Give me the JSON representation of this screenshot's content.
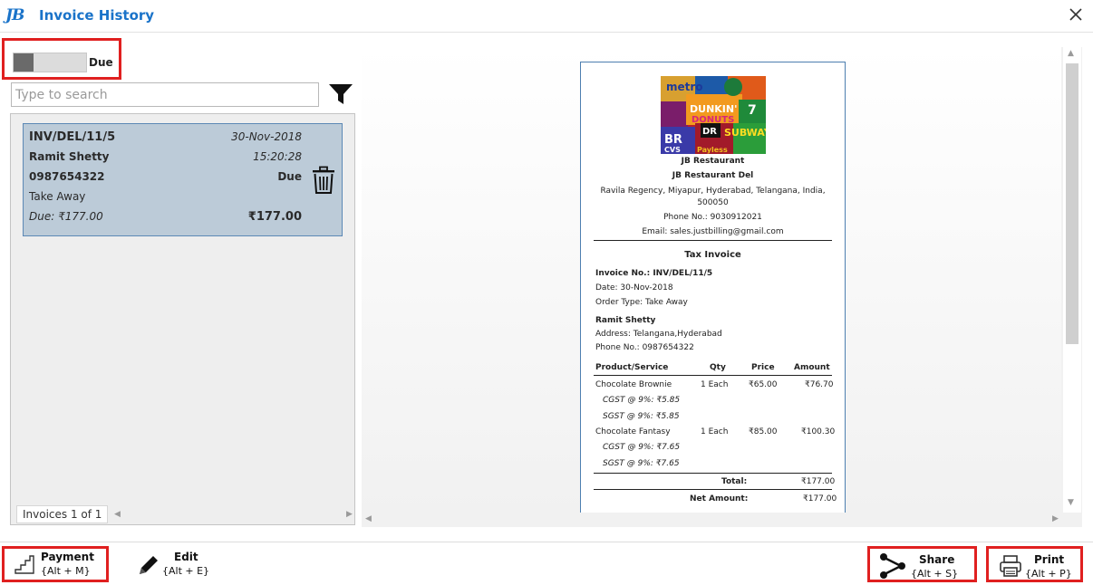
{
  "window": {
    "logo": "JB",
    "title": "Invoice History"
  },
  "toggle": {
    "label": "Due"
  },
  "search": {
    "placeholder": "Type to search"
  },
  "invoices": [
    {
      "number": "INV/DEL/11/5",
      "date": "30-Nov-2018",
      "customer": "Ramit Shetty",
      "time": "15:20:28",
      "phone": "0987654322",
      "status": "Due",
      "order_type": "Take Away",
      "due": "Due: ₹177.00",
      "total": "₹177.00"
    }
  ],
  "list_status": "Invoices 1 of 1",
  "receipt": {
    "business_name": "JB Restaurant",
    "branch_name": "JB Restaurant Del",
    "address_line1": "Ravila Regency, Miyapur, Hyderabad, Telangana, India,",
    "address_line2": "500050",
    "phone": "Phone No.: 9030912021",
    "email": "Email: sales.justbilling@gmail.com",
    "doc_title": "Tax Invoice",
    "invoice_no": "Invoice No.: INV/DEL/11/5",
    "date": "Date: 30-Nov-2018",
    "order_type": "Order Type: Take Away",
    "customer_name": "Ramit Shetty",
    "customer_address": "Address: Telangana,Hyderabad",
    "customer_phone": "Phone No.: 0987654322",
    "columns": [
      "Product/Service",
      "Qty",
      "Price",
      "Amount"
    ],
    "items": [
      {
        "name": "Chocolate Brownie",
        "qty": "1 Each",
        "price": "₹65.00",
        "amount": "₹76.70",
        "taxes": [
          "CGST @ 9%: ₹5.85",
          "SGST @ 9%: ₹5.85"
        ]
      },
      {
        "name": "Chocolate Fantasy",
        "qty": "1 Each",
        "price": "₹85.00",
        "amount": "₹100.30",
        "taxes": [
          "CGST @ 9%: ₹7.65",
          "SGST @ 9%: ₹7.65"
        ]
      }
    ],
    "total_label": "Total:",
    "total_value": "₹177.00",
    "net_label": "Net Amount:",
    "net_value": "₹177.00",
    "logo_words": [
      "metro",
      "DUNKIN'",
      "DONUTS",
      "SUBWAY",
      "BR",
      "CVS",
      "7",
      "Payless",
      "DR"
    ]
  },
  "toolbar": {
    "payment": {
      "label": "Payment",
      "shortcut": "{Alt + M}"
    },
    "edit": {
      "label": "Edit",
      "shortcut": "{Alt + E}"
    },
    "share": {
      "label": "Share",
      "shortcut": "{Alt + S}"
    },
    "print": {
      "label": "Print",
      "shortcut": "{Alt + P}"
    }
  },
  "colors": {
    "accent": "#1a73c9",
    "highlight_border": "#e02020",
    "selected_card": "#bccbd8",
    "selected_card_border": "#5c88b5"
  }
}
